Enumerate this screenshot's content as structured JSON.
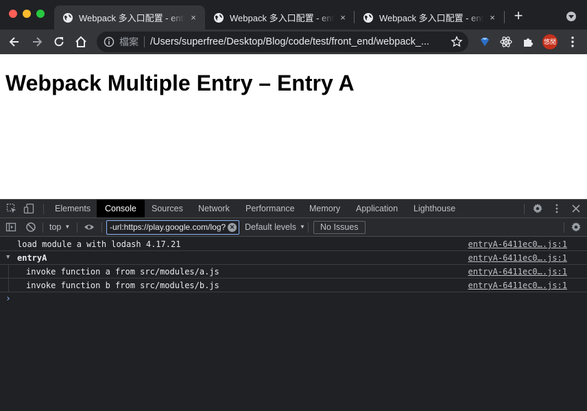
{
  "browser": {
    "tabs": [
      {
        "title": "Webpack 多入口配置 - entry",
        "active": true
      },
      {
        "title": "Webpack 多入口配置 - entry",
        "active": false
      },
      {
        "title": "Webpack 多入口配置 - entry",
        "active": false
      }
    ],
    "close_glyph": "×",
    "newtab_glyph": "+",
    "omnibox": {
      "security_label": "檔案",
      "url": "/Users/superfree/Desktop/Blog/code/test/front_end/webpack_..."
    },
    "avatar_text": "悠閒"
  },
  "page": {
    "heading": "Webpack Multiple Entry – Entry A"
  },
  "devtools": {
    "tabs": [
      "Elements",
      "Console",
      "Sources",
      "Network",
      "Performance",
      "Memory",
      "Application",
      "Lighthouse"
    ],
    "active_tab": "Console",
    "context": "top",
    "filter_value": "-url:https://play.google.com/log?",
    "levels": "Default levels",
    "issues": "No Issues",
    "messages": [
      {
        "text": "load module a with lodash 4.17.21",
        "source": "entryA-6411ec0….js:1"
      },
      {
        "text": "entryA",
        "source": "entryA-6411ec0….js:1",
        "group": true
      },
      {
        "text": "invoke function a from src/modules/a.js",
        "source": "entryA-6411ec0….js:1"
      },
      {
        "text": "invoke function b from src/modules/b.js",
        "source": "entryA-6411ec0….js:1"
      }
    ],
    "prompt": "›"
  },
  "colors": {
    "accent": "#8ab4f8",
    "chrome_dark": "#202124",
    "toolbar": "#35363a",
    "avatar": "#c5311d"
  }
}
